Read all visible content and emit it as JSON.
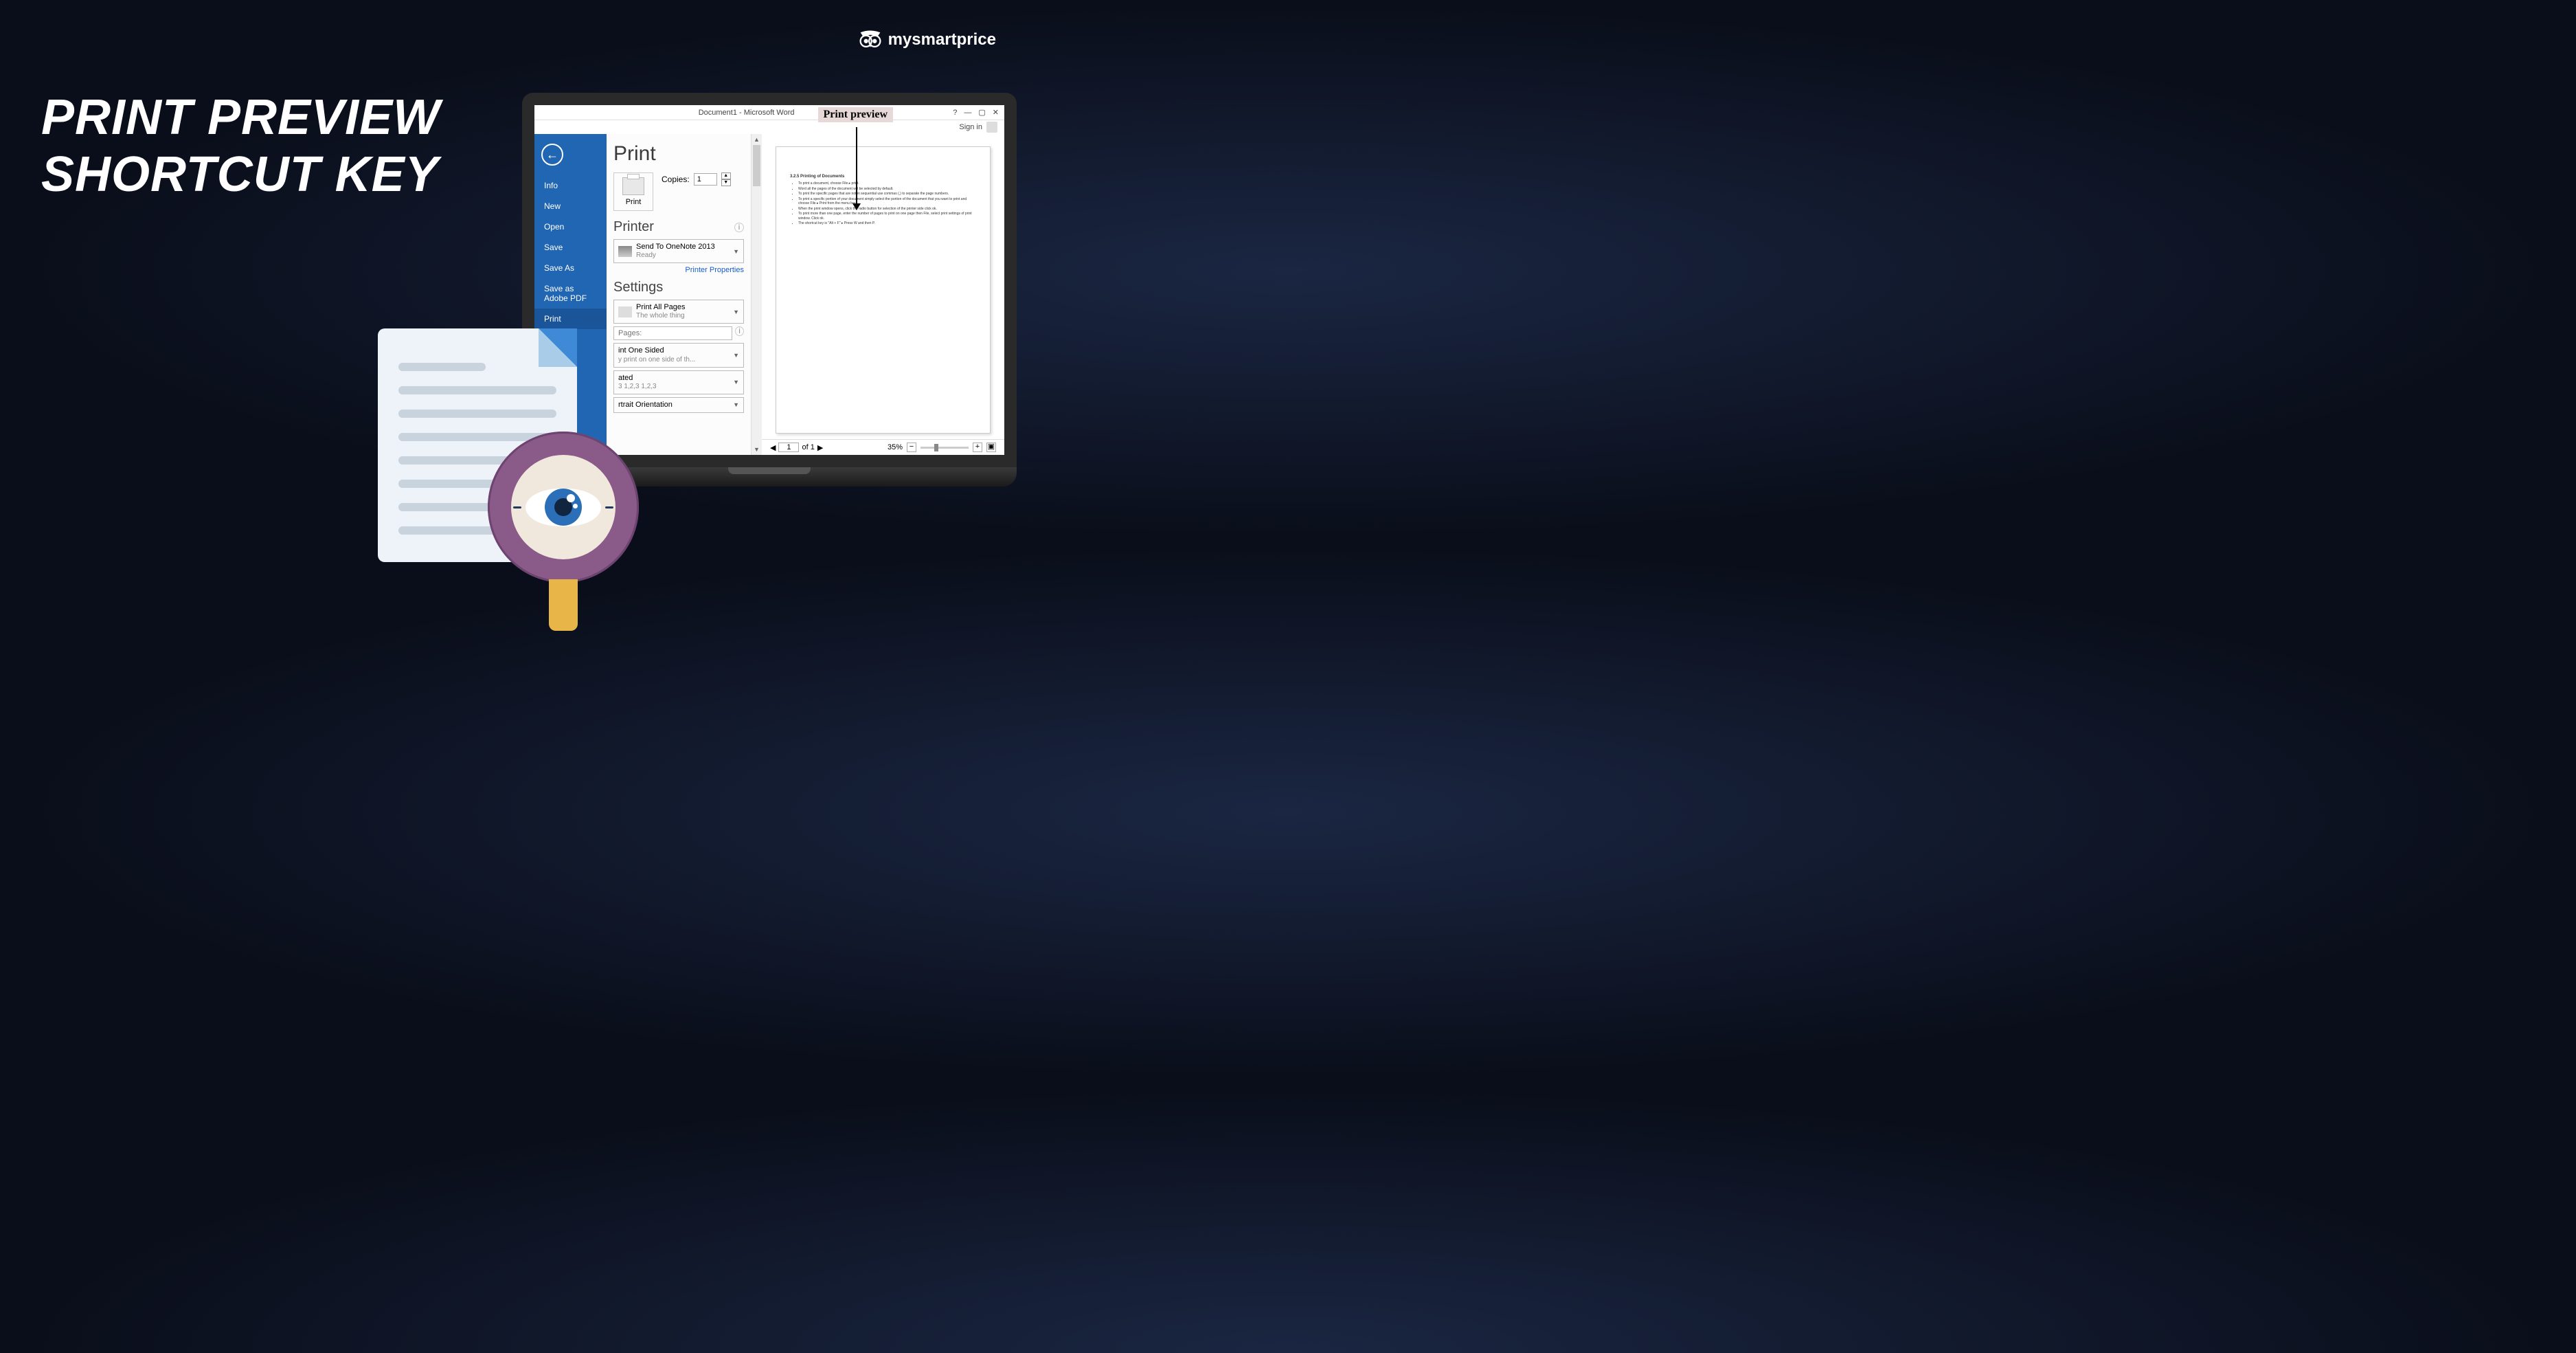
{
  "hero": {
    "line1": "PRINT PREVIEW",
    "line2": "SHORTCUT KEY"
  },
  "brand": {
    "name": "mysmartprice"
  },
  "callout": {
    "label": "Print preview"
  },
  "word": {
    "title": "Document1 - Microsoft Word",
    "help": "?",
    "signin": "Sign in",
    "sidebar": [
      "Info",
      "New",
      "Open",
      "Save",
      "Save As",
      "Save as Adobe PDF",
      "Print"
    ],
    "print": {
      "heading": "Print",
      "button": "Print",
      "copies_label": "Copies:",
      "copies_value": "1",
      "printer_heading": "Printer",
      "printer_name": "Send To OneNote 2013",
      "printer_status": "Ready",
      "printer_props": "Printer Properties",
      "settings_heading": "Settings",
      "pages_opt": "Print All Pages",
      "pages_sub": "The whole thing",
      "pages_placeholder": "Pages:",
      "sided": "int One Sided",
      "sided_sub": "y print on one side of th...",
      "collated": "ated",
      "collated_sub": "3   1,2,3   1,2,3",
      "orientation": "rtrait Orientation"
    },
    "preview": {
      "page_current": "1",
      "page_total": "of 1",
      "zoom": "35%",
      "doc_heading": "3.2.5 Printing of Documents",
      "doc_lines": [
        "To print a document, choose File ▸ print.",
        "Word all the pages of the document will be selected by default.",
        "To print the specific pages that are not in sequential use commas (,) to separate the page numbers.",
        "To print a specific portion of your document simply select the portion of the document that you want to print and choose File ▸ Print from the menu bar.",
        "When the print window opens, click the radio button for selection of the printer side click ok.",
        "To print more than one page, enter the number of pages to print on one page then File, select print settings of print window. Click ok.",
        "The shortcut key is \"Alt + F\" ▸ Press W and then P."
      ]
    }
  }
}
